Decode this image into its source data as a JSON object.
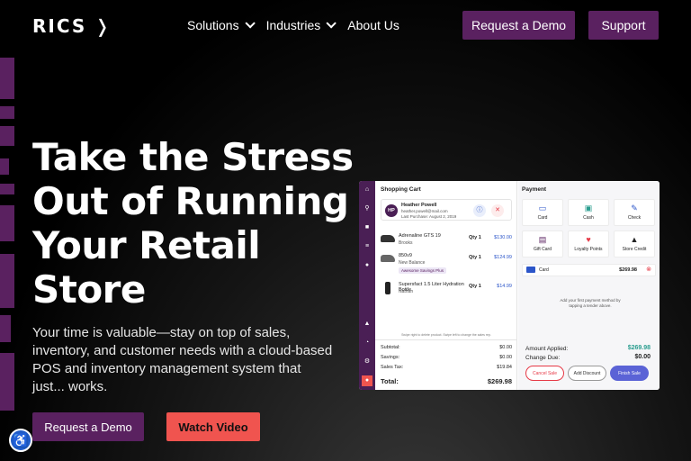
{
  "nav": {
    "logo": "RICS",
    "links": [
      {
        "label": "Solutions"
      },
      {
        "label": "Industries"
      },
      {
        "label": "About Us"
      }
    ],
    "request_demo": "Request a Demo",
    "support": "Support"
  },
  "hero": {
    "title": "Take the Stress Out of Running Your Retail Store",
    "subtitle": "Your time is valuable—stay on top of sales, inventory, and customer needs with a cloud-based POS and inventory management system that just... works.",
    "cta_demo": "Request a Demo",
    "cta_video": "Watch Video"
  },
  "pos": {
    "cart_title": "Shopping Cart",
    "customer": {
      "initials": "HP",
      "name": "Heather Powell",
      "email": "heather.powell@mail.com",
      "last_purchase": "Last Purchase: August 2, 2019"
    },
    "items": [
      {
        "name": "Adrenaline GTS 19",
        "brand": "Brooks",
        "qty": "Qty 1",
        "price": "$130.00",
        "tag": ""
      },
      {
        "name": "850v9",
        "brand": "New Balance",
        "qty": "Qty 1",
        "price": "$124.99",
        "tag": "Awesome Savings Plus"
      },
      {
        "name": "Supersfact 1.5 Liter Hydration Bottle",
        "brand": "Nathan",
        "qty": "Qty 1",
        "price": "$14.99",
        "tag": ""
      }
    ],
    "cart_hint": "Swipe right to delete product. Swipe left to change the sales rep.",
    "totals": [
      {
        "label": "Subtotal:",
        "value": "$0.00"
      },
      {
        "label": "Savings:",
        "value": "$0.00"
      },
      {
        "label": "Sales Tax:",
        "value": "$19.84"
      }
    ],
    "total_label": "Total:",
    "total_value": "$269.98",
    "payment_title": "Payment",
    "tenders": [
      {
        "label": "Card",
        "icon": "card-icon",
        "glyph": "▭",
        "color": "#2b55c9"
      },
      {
        "label": "Cash",
        "icon": "cash-icon",
        "glyph": "▣",
        "color": "#2a9d8f"
      },
      {
        "label": "Check",
        "icon": "check-icon",
        "glyph": "✎",
        "color": "#2b55c9"
      },
      {
        "label": "Gift Card",
        "icon": "gift-card-icon",
        "glyph": "▤",
        "color": "#5a2160"
      },
      {
        "label": "Loyalty Points",
        "icon": "heart-icon",
        "glyph": "♥",
        "color": "#e63946"
      },
      {
        "label": "Store Credit",
        "icon": "store-credit-icon",
        "glyph": "▲",
        "color": "#222222"
      }
    ],
    "applied": {
      "method": "Card",
      "amount": "$269.98"
    },
    "payment_hint": "Add your first payment method by tapping a tender above.",
    "amount_applied_label": "Amount Applied:",
    "amount_applied_value": "$269.98",
    "change_due_label": "Change Due:",
    "change_due_value": "$0.00",
    "cancel": "Cancel Sale",
    "discount": "Add Discount",
    "finish": "Finish Sale"
  },
  "colors": {
    "brand_purple": "#5a2160",
    "cta_red": "#f0544f",
    "pos_sidebar": "#4a1f55",
    "accent_blue": "#2b55c9",
    "accent_green": "#2a9d8f"
  }
}
